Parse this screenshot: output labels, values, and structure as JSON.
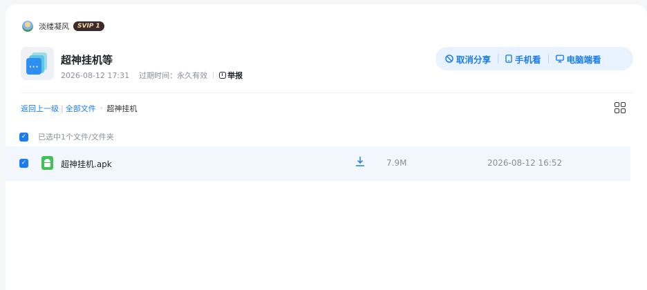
{
  "owner": {
    "name": "淡缕凝风",
    "badge": "SVIP 1"
  },
  "share": {
    "title": "超神挂机等",
    "created": "2026-08-12 17:31",
    "expiry": "过期时间：永久有效",
    "report": "举报"
  },
  "actions": {
    "cancel_share": "取消分享",
    "phone_view": "手机看",
    "pc_view": "电脑端看"
  },
  "breadcrumb": {
    "back": "返回上一级",
    "all_files": "全部文件",
    "current": "超神挂机"
  },
  "selection": {
    "summary": "已选中1个文件/文件夹"
  },
  "files": [
    {
      "name": "超神挂机.apk",
      "size": "7.9M",
      "date": "2026-08-12 16:52"
    }
  ],
  "colors": {
    "accent": "#1a7cf0",
    "selected_row": "#f1f7fd",
    "apk": "#42c15a"
  }
}
